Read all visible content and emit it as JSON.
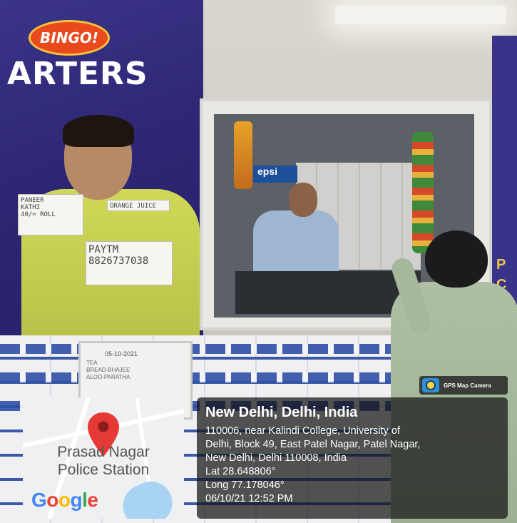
{
  "poster": {
    "brand": "BINGO!",
    "headline": "ARTERS",
    "note_paneer": [
      "PANEER",
      "KATHI",
      "40/= ROLL"
    ],
    "note_paytm": [
      "PAYTM",
      "8826737038"
    ],
    "note_small": "ORANGE JUICE",
    "right_letters": [
      "P",
      "C"
    ]
  },
  "window": {
    "pepsi_sign": "epsi"
  },
  "notice_board": {
    "date": "05-10-2021",
    "lines": [
      "TEA",
      "BREAD-BHAJEE",
      "ALOO-PARATHA"
    ]
  },
  "overlay": {
    "badge": "GPS Map Camera",
    "map": {
      "place_line1": "Prasad Nagar",
      "place_line2": "Police Station",
      "google": [
        "G",
        "o",
        "o",
        "g",
        "l",
        "e"
      ]
    },
    "location": {
      "title": "New Delhi, Delhi, India",
      "address": [
        "110006, near Kalindi College, University of",
        "Delhi, Block 49, East Patel Nagar, Patel Nagar,",
        "New Delhi, Delhi 110008, India"
      ],
      "lat": "Lat 28.648806°",
      "long": "Long 77.178046°",
      "datetime": "06/10/21 12:52 PM"
    }
  },
  "colors": {
    "poster_purple": "#2d2775",
    "overlay_bg": "rgba(20,20,20,0.72)",
    "pin_red": "#e53935"
  }
}
